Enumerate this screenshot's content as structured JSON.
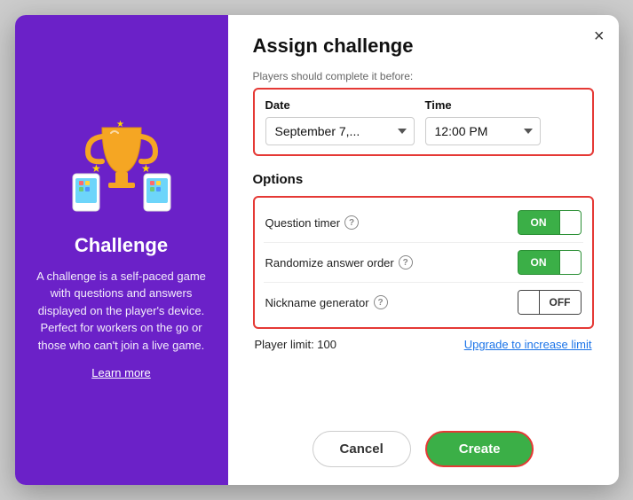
{
  "left": {
    "title": "Challenge",
    "description": "A challenge is a self-paced game with questions and answers displayed on the player's device. Perfect for workers on the go or those who can't join a live game.",
    "learn_more": "Learn more",
    "bg_color": "#6B21C8"
  },
  "right": {
    "title": "Assign challenge",
    "close_label": "×",
    "deadline_label": "Players should complete it before:",
    "date_column": "Date",
    "time_column": "Time",
    "date_value": "September 7,...",
    "time_value": "12:00 PM",
    "options_title": "Options",
    "options": [
      {
        "label": "Question timer",
        "state": "on"
      },
      {
        "label": "Randomize answer order",
        "state": "on"
      },
      {
        "label": "Nickname generator",
        "state": "off"
      }
    ],
    "player_limit_label": "Player limit: 100",
    "upgrade_link": "Upgrade to increase limit",
    "cancel_label": "Cancel",
    "create_label": "Create"
  },
  "icons": {
    "help": "?",
    "close": "✕"
  }
}
